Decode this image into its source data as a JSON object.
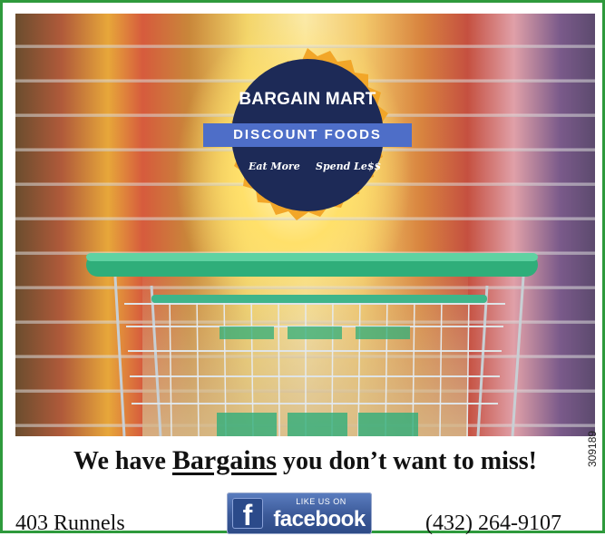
{
  "logo": {
    "title": "BARGAIN MART",
    "subtitle": "DISCOUNT FOODS",
    "tagline_left": "Eat More",
    "tagline_right": "Spend Le$$",
    "colors": {
      "ring": "#f2a628",
      "center": "#1d2a57",
      "banner": "#4e6ec8"
    }
  },
  "headline": {
    "before": "We have ",
    "emphasis": "Bargains",
    "after": " you don’t want to miss!"
  },
  "contact": {
    "address": "403 Runnels",
    "phone": "(432) 264-9107"
  },
  "facebook": {
    "like_text": "LIKE US ON",
    "brand_text": "facebook",
    "icon": "facebook-icon"
  },
  "ad_id": "309189",
  "colors": {
    "border": "#2e9a3c",
    "cart": "#2fae7a"
  }
}
